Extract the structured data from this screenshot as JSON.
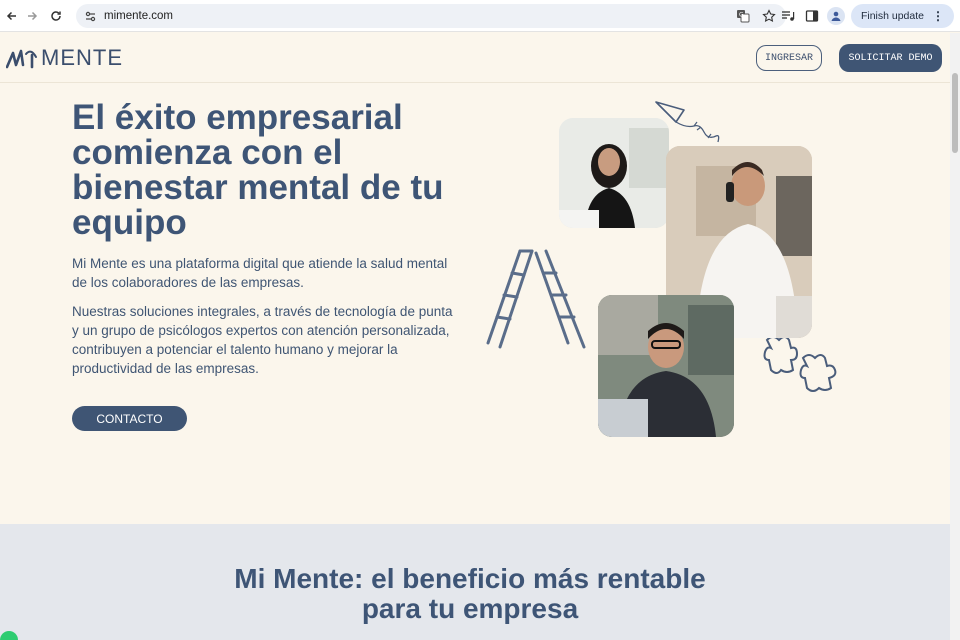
{
  "browser": {
    "url": "mimente.com",
    "finish_update_label": "Finish update"
  },
  "header": {
    "logo_text": "MENTE",
    "ingresar_label": "INGRESAR",
    "demo_label": "SOLICITAR DEMO"
  },
  "hero": {
    "title": "El éxito empresarial comienza con el bienestar mental de tu equipo",
    "paragraph_1": "Mi Mente es una plataforma digital que atiende la salud mental de los colaboradores de las empresas.",
    "paragraph_2": "Nuestras soluciones integrales, a través de tecnología de punta y un grupo de psicólogos expertos con atención personalizada, contribuyen a potenciar el talento humano y mejorar la productividad de las empresas.",
    "cta_label": "CONTACTO"
  },
  "section2": {
    "title_line1": "Mi Mente: el beneficio más rentable",
    "title_line2": "para tu empresa"
  },
  "colors": {
    "brand_navy": "#3f5574",
    "page_bg": "#fbf6ec",
    "section_bg": "#e4e7ec"
  }
}
